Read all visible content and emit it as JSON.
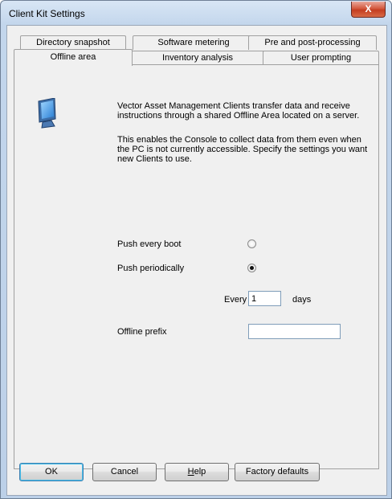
{
  "window": {
    "title": "Client Kit Settings",
    "close_label": "X"
  },
  "tabs": {
    "row_back": [
      "Directory snapshot",
      "Software metering",
      "Pre and post-processing"
    ],
    "row_front": [
      "Offline area",
      "Inventory analysis",
      "User prompting"
    ],
    "selected": "Offline area"
  },
  "offline": {
    "icon": "monitor-icon",
    "paragraph1": "Vector Asset Management Clients transfer data and receive instructions through a shared Offline Area located on a server.",
    "paragraph2": "This enables the Console to collect data from them even when the PC is not currently accessible. Specify the settings you want new Clients to use.",
    "push_every_boot_label": "Push every boot",
    "push_every_boot_checked": false,
    "push_periodically_label": "Push periodically",
    "push_periodically_checked": true,
    "every_label": "Every",
    "every_value": "1",
    "days_label": "days",
    "prefix_label": "Offline prefix",
    "prefix_value": ""
  },
  "buttons": {
    "ok": "OK",
    "cancel": "Cancel",
    "help": "Help",
    "factory": "Factory defaults"
  }
}
